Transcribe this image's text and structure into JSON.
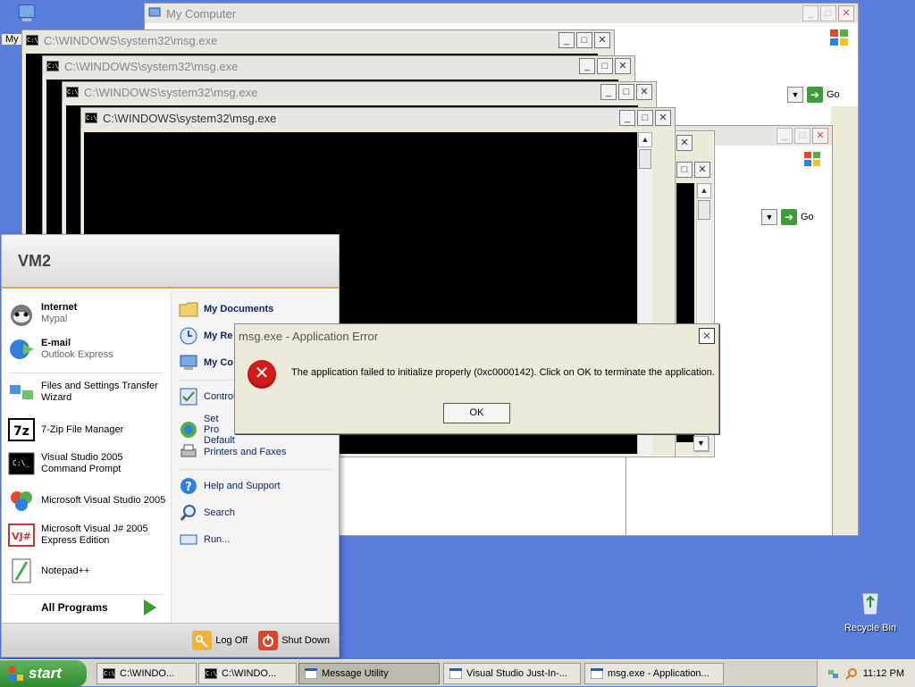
{
  "desktop": {
    "recycle_bin_label": "Recycle Bin",
    "partial_icon_label": "My"
  },
  "windows": {
    "my_computer": {
      "title": "My Computer",
      "go_label": "Go"
    },
    "back_window": {
      "go_label": "Go"
    },
    "consoles": [
      {
        "title": "C:\\WINDOWS\\system32\\msg.exe"
      },
      {
        "title": "C:\\WINDOWS\\system32\\msg.exe"
      },
      {
        "title": "C:\\WINDOWS\\system32\\msg.exe"
      },
      {
        "title": "C:\\WINDOWS\\system32\\msg.exe"
      }
    ]
  },
  "start_menu": {
    "user": "VM2",
    "left_items": [
      {
        "title": "Internet",
        "subtitle": "Mypal"
      },
      {
        "title": "E-mail",
        "subtitle": "Outlook Express"
      },
      {
        "label": "Files and Settings Transfer Wizard"
      },
      {
        "label": "7-Zip File Manager"
      },
      {
        "label": "Visual Studio 2005 Command Prompt"
      },
      {
        "label": "Microsoft Visual Studio 2005"
      },
      {
        "label": "Microsoft Visual J# 2005 Express Edition"
      },
      {
        "label": "Notepad++"
      }
    ],
    "all_programs": "All Programs",
    "right_items": [
      {
        "label": "My Documents"
      },
      {
        "label": "My Re"
      },
      {
        "label": "My Co"
      },
      {
        "label": "Control"
      },
      {
        "label": "Set Pro Default"
      },
      {
        "label": "Printers and Faxes"
      },
      {
        "label": "Help and Support"
      },
      {
        "label": "Search"
      },
      {
        "label": "Run..."
      }
    ],
    "log_off": "Log Off",
    "shut_down": "Shut Down"
  },
  "dialog": {
    "title": "msg.exe - Application Error",
    "message": "The application failed to initialize properly (0xc0000142). Click on OK to terminate the application.",
    "ok_label": "OK"
  },
  "taskbar": {
    "start_label": "start",
    "tasks": [
      {
        "label": "C:\\WINDO..."
      },
      {
        "label": "C:\\WINDO..."
      },
      {
        "label": "Message Utility"
      },
      {
        "label": "Visual Studio Just-In-..."
      },
      {
        "label": "msg.exe - Application..."
      }
    ],
    "clock": "11:12 PM"
  },
  "colors": {
    "desktop": "#5a7edc",
    "error_red": "#d31b1b",
    "start_green": "#3c9b30"
  }
}
